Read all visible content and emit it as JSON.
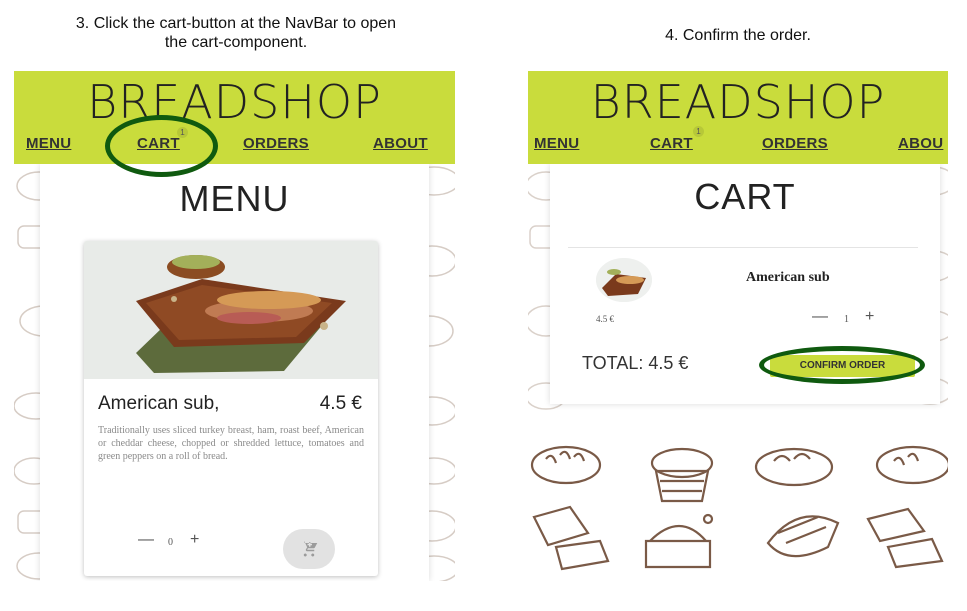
{
  "captions": {
    "step3_line1": "3. Click the cart-button at the NavBar to open",
    "step3_line2": "the cart-component.",
    "step4": "4. Confirm the order."
  },
  "app": {
    "brand": "BREADSHOP",
    "nav": {
      "menu": "MENU",
      "cart": "CART",
      "orders": "ORDERS",
      "about": "ABOUT",
      "about_truncated": "ABOU"
    },
    "cart_badge": "1"
  },
  "menu_screen": {
    "heading": "MENU",
    "product": {
      "name": "American sub,",
      "price": "4.5 €",
      "description": "Traditionally uses sliced turkey breast, ham, roast beef, American or cheddar cheese, chopped or shredded lettuce, tomatoes and green peppers on a roll of bread.",
      "quantity": "0",
      "minus": "—",
      "plus": "+"
    },
    "cart_icon": "add-shopping-cart-icon"
  },
  "cart_screen": {
    "heading": "CART",
    "item_name": "American sub",
    "item_price": "4.5 €",
    "quantity": "1",
    "minus": "—",
    "plus": "+",
    "total": "TOTAL: 4.5 €",
    "confirm": "CONFIRM ORDER"
  },
  "colors": {
    "header": "#c9dc3c",
    "highlight_ring": "#0f5a0f",
    "doodle": "#8a6a55"
  }
}
